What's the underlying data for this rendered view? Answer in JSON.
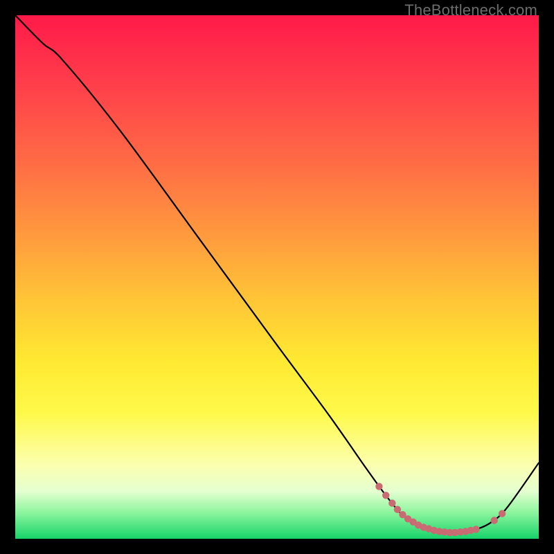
{
  "watermark": "TheBottleneck.com",
  "colors": {
    "curve_stroke": "#000000",
    "marker_fill": "#c96b72",
    "marker_stroke": "#c96b72"
  },
  "chart_data": {
    "type": "line",
    "title": "",
    "xlabel": "",
    "ylabel": "",
    "xlim": [
      0,
      100
    ],
    "ylim": [
      0,
      100
    ],
    "note": "No axis ticks or numeric labels are shown in the image; x/y are normalized 0–100 estimated from pixel position inside the 756×756 plot area.",
    "series": [
      {
        "name": "curve",
        "points": [
          {
            "x": 0.0,
            "y": 100.0
          },
          {
            "x": 5.3,
            "y": 94.6
          },
          {
            "x": 9.0,
            "y": 91.5
          },
          {
            "x": 20.0,
            "y": 78.0
          },
          {
            "x": 35.0,
            "y": 57.5
          },
          {
            "x": 50.0,
            "y": 37.0
          },
          {
            "x": 60.0,
            "y": 23.5
          },
          {
            "x": 67.0,
            "y": 13.5
          },
          {
            "x": 71.0,
            "y": 8.0
          },
          {
            "x": 74.0,
            "y": 4.5
          },
          {
            "x": 77.0,
            "y": 2.5
          },
          {
            "x": 80.0,
            "y": 1.5
          },
          {
            "x": 84.0,
            "y": 1.2
          },
          {
            "x": 88.0,
            "y": 1.8
          },
          {
            "x": 91.0,
            "y": 3.2
          },
          {
            "x": 94.0,
            "y": 6.0
          },
          {
            "x": 100.0,
            "y": 14.5
          }
        ]
      }
    ],
    "markers": [
      {
        "x": 69.5,
        "y": 10.0
      },
      {
        "x": 70.8,
        "y": 8.3
      },
      {
        "x": 72.0,
        "y": 6.8
      },
      {
        "x": 73.0,
        "y": 5.6
      },
      {
        "x": 74.0,
        "y": 4.6
      },
      {
        "x": 75.0,
        "y": 3.8
      },
      {
        "x": 76.0,
        "y": 3.2
      },
      {
        "x": 77.0,
        "y": 2.6
      },
      {
        "x": 78.0,
        "y": 2.2
      },
      {
        "x": 79.0,
        "y": 1.9
      },
      {
        "x": 80.0,
        "y": 1.6
      },
      {
        "x": 81.0,
        "y": 1.4
      },
      {
        "x": 82.0,
        "y": 1.3
      },
      {
        "x": 83.0,
        "y": 1.2
      },
      {
        "x": 84.0,
        "y": 1.2
      },
      {
        "x": 85.0,
        "y": 1.3
      },
      {
        "x": 86.0,
        "y": 1.4
      },
      {
        "x": 87.0,
        "y": 1.6
      },
      {
        "x": 88.0,
        "y": 1.8
      },
      {
        "x": 91.5,
        "y": 3.5
      },
      {
        "x": 93.0,
        "y": 4.8
      }
    ]
  }
}
